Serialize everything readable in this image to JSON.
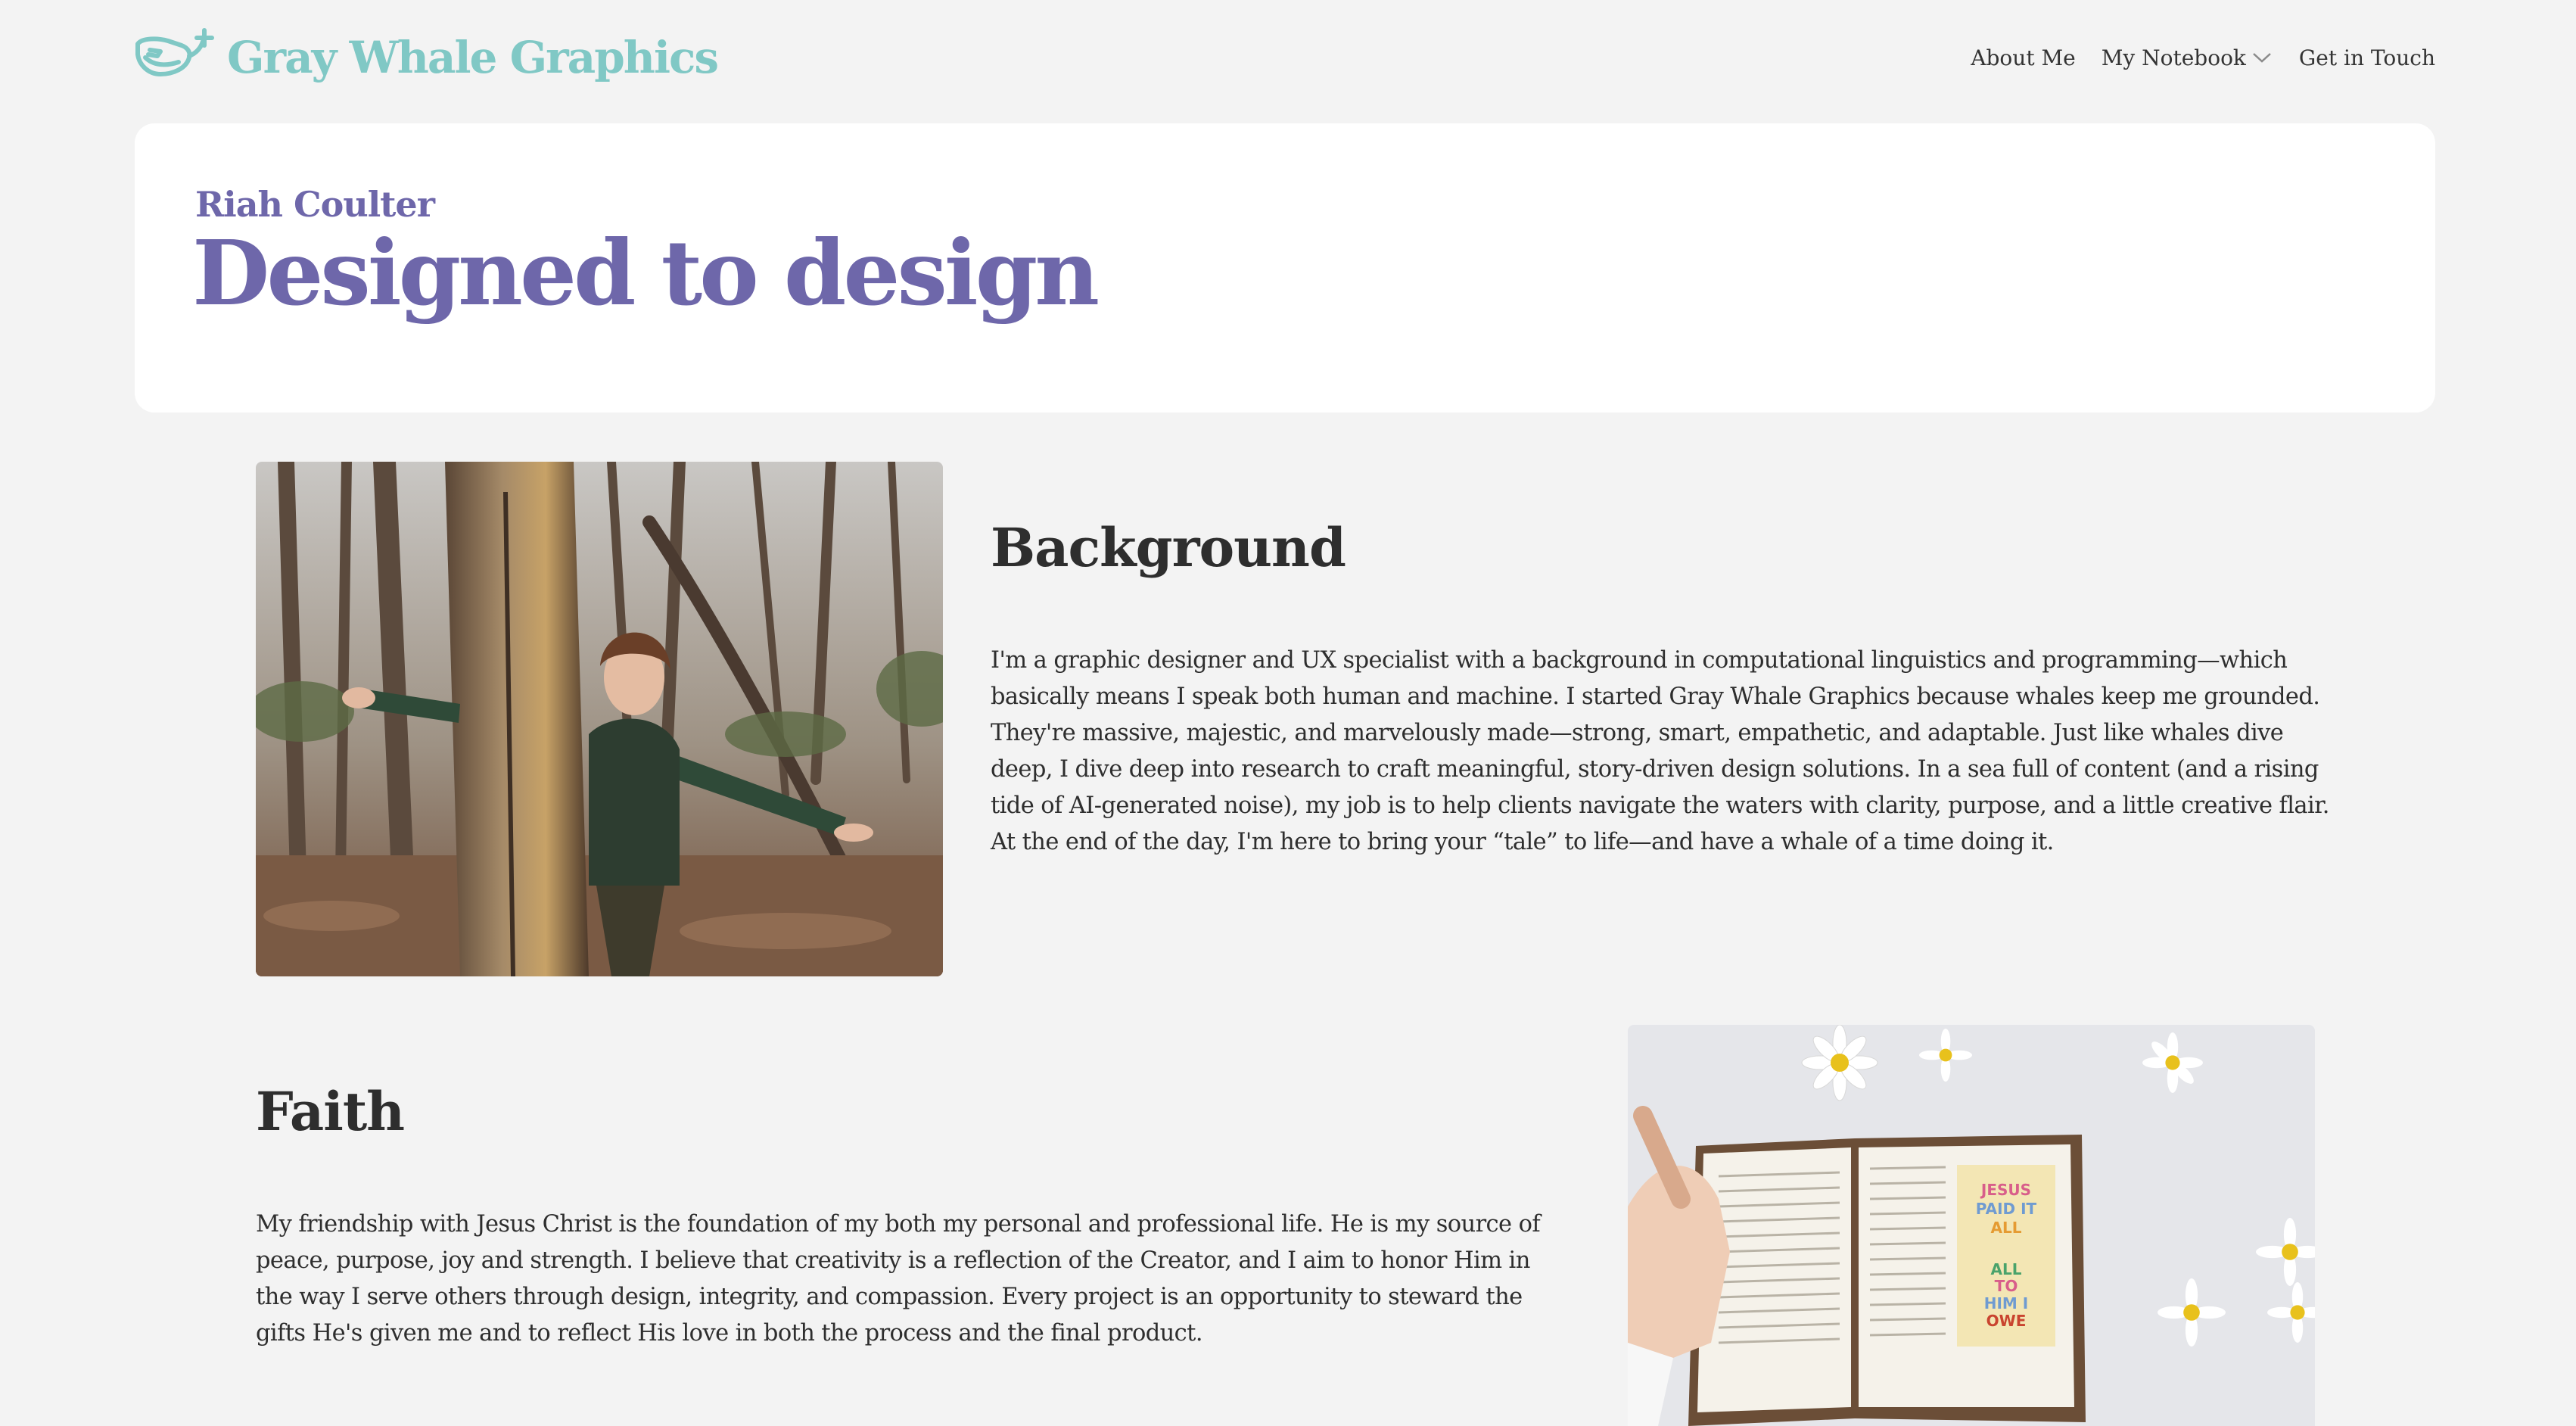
{
  "header": {
    "brand_name": "Gray Whale Graphics",
    "logo_icon": "whale-icon",
    "nav": {
      "about": "About Me",
      "notebook": "My Notebook",
      "contact": "Get in Touch"
    }
  },
  "hero": {
    "subtitle": "Riah Coulter",
    "title": "Designed to design"
  },
  "background": {
    "heading": "Background",
    "body": "I'm a graphic designer and UX specialist with a background in computational linguistics and programming—which basically means I speak both human and machine. I started Gray Whale Graphics because whales keep me grounded. They're massive, majestic, and marvelously made—strong, smart, empathetic, and adaptable. Just like whales dive deep, I dive deep into research to craft meaningful, story-driven design solutions. In a sea full of content (and a rising tide of AI-generated noise), my job is to help clients navigate the waters with clarity, purpose, and a little creative flair. At the end of the day, I'm here to bring your “tale” to life—and have a whale of a time doing it."
  },
  "faith": {
    "heading": "Faith",
    "body": "My friendship with Jesus Christ is the foundation of my both my personal and professional life. He is my source of peace, purpose, joy and strength. I believe that creativity is a reflection of the Creator, and I aim to honor Him in the way I serve others through design, integrity, and compassion. Every project is an opportunity to steward the gifts He's given me and to reflect His love in both the process and the final product."
  },
  "colors": {
    "brand_teal": "#80c8c5",
    "accent_purple": "#6e67aa",
    "page_bg": "#f3f3f3",
    "card_bg": "#ffffff"
  }
}
